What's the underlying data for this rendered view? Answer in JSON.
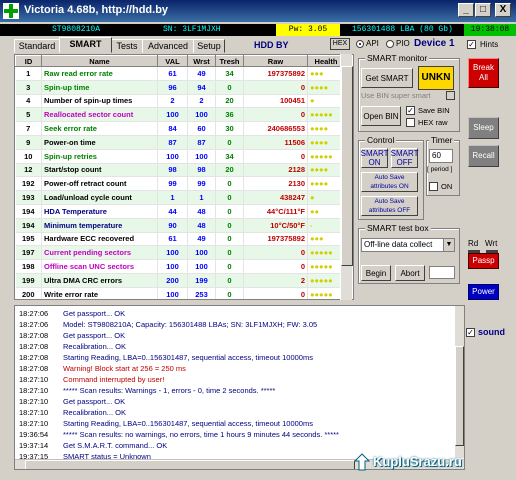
{
  "window": {
    "title": "Victoria 4.68b, http://hdd.by",
    "minimize_glyph": "_",
    "maximize_glyph": "□",
    "close_glyph": "X"
  },
  "infobar": {
    "model": "ST9808210A",
    "serial": "SN: 3LF1MJXH",
    "power": "Pw: 3.05",
    "capacity": "156301488 LBA (80 Gb)",
    "clock": "19:38:08"
  },
  "tabs": [
    "Standard",
    "SMART",
    "Tests",
    "Advanced",
    "Setup"
  ],
  "active_tab": "SMART",
  "toolbar": {
    "hdd_label": "HDD BY",
    "hex_button": "HEX",
    "api_label": "API",
    "pio_label": "PIO",
    "device_label": "Device 1",
    "hints_label": "Hints",
    "hints_checked": true
  },
  "smart_table": {
    "columns": [
      "ID",
      "Name",
      "VAL",
      "Wrst",
      "Tresh",
      "Raw",
      "Health"
    ],
    "rows": [
      {
        "id": "1",
        "name": "Raw read error rate",
        "val": "61",
        "wrst": "49",
        "tresh": "34",
        "raw": "197375892",
        "health": "●●●",
        "name_color": "#008000"
      },
      {
        "id": "3",
        "name": "Spin-up time",
        "val": "96",
        "wrst": "94",
        "tresh": "0",
        "raw": "0",
        "health": "●●●●",
        "name_color": "#008000"
      },
      {
        "id": "4",
        "name": "Number of spin-up times",
        "val": "2",
        "wrst": "2",
        "tresh": "20",
        "raw": "100451",
        "health": "●",
        "name_color": "#000000"
      },
      {
        "id": "5",
        "name": "Reallocated sector count",
        "val": "100",
        "wrst": "100",
        "tresh": "36",
        "raw": "0",
        "health": "●●●●●",
        "name_color": "#c000c0"
      },
      {
        "id": "7",
        "name": "Seek error rate",
        "val": "84",
        "wrst": "60",
        "tresh": "30",
        "raw": "240686553",
        "health": "●●●●",
        "name_color": "#008000"
      },
      {
        "id": "9",
        "name": "Power-on time",
        "val": "87",
        "wrst": "87",
        "tresh": "0",
        "raw": "11506",
        "health": "●●●●",
        "name_color": "#000000"
      },
      {
        "id": "10",
        "name": "Spin-up retries",
        "val": "100",
        "wrst": "100",
        "tresh": "34",
        "raw": "0",
        "health": "●●●●●",
        "name_color": "#008000"
      },
      {
        "id": "12",
        "name": "Start/stop count",
        "val": "98",
        "wrst": "98",
        "tresh": "20",
        "raw": "2128",
        "health": "●●●●",
        "name_color": "#000000"
      },
      {
        "id": "192",
        "name": "Power-off retract count",
        "val": "99",
        "wrst": "99",
        "tresh": "0",
        "raw": "2130",
        "health": "●●●●",
        "name_color": "#000000"
      },
      {
        "id": "193",
        "name": "Load/unload cycle count",
        "val": "1",
        "wrst": "1",
        "tresh": "0",
        "raw": "438247",
        "health": "●",
        "name_color": "#000000"
      },
      {
        "id": "194",
        "name": "HDA Temperature",
        "val": "44",
        "wrst": "48",
        "tresh": "0",
        "raw": "44°C/111°F",
        "health": "●●",
        "name_color": "#000080"
      },
      {
        "id": "194",
        "name": "Minimum temperature",
        "val": "90",
        "wrst": "48",
        "tresh": "0",
        "raw": "10°C/50°F",
        "health": "-",
        "name_color": "#000080"
      },
      {
        "id": "195",
        "name": "Hardware ECC recovered",
        "val": "61",
        "wrst": "49",
        "tresh": "0",
        "raw": "197375892",
        "health": "●●●",
        "name_color": "#000000"
      },
      {
        "id": "197",
        "name": "Current pending sectors",
        "val": "100",
        "wrst": "100",
        "tresh": "0",
        "raw": "0",
        "health": "●●●●●",
        "name_color": "#c000c0"
      },
      {
        "id": "198",
        "name": "Offline scan UNC sectors",
        "val": "100",
        "wrst": "100",
        "tresh": "0",
        "raw": "0",
        "health": "●●●●●",
        "name_color": "#c000c0"
      },
      {
        "id": "199",
        "name": "Ultra DMA CRC errors",
        "val": "200",
        "wrst": "199",
        "tresh": "0",
        "raw": "2",
        "health": "●●●●●",
        "name_color": "#000000"
      },
      {
        "id": "200",
        "name": "Write error rate",
        "val": "100",
        "wrst": "253",
        "tresh": "0",
        "raw": "0",
        "health": "●●●●●",
        "name_color": "#000000"
      }
    ]
  },
  "smart_monitor": {
    "title": "SMART monitor",
    "get_smart": "Get SMART",
    "status": "UNKN",
    "use_bin": "Use BIN super smart",
    "open_bin": "Open BIN",
    "save_bin": "Save BIN",
    "save_bin_checked": true,
    "hex_raw": "HEX raw",
    "hex_raw_checked": false
  },
  "control": {
    "title": "Control",
    "smart_on": "SMART ON",
    "smart_off": "SMART OFF",
    "autosave_on": "Auto Save attributes ON",
    "autosave_off": "Auto Save attributes OFF"
  },
  "timer": {
    "title": "Timer",
    "value": "60",
    "period": "[ period ]",
    "on_label": "ON"
  },
  "test_box": {
    "title": "SMART test box",
    "selected": "Off-line data collect",
    "begin": "Begin",
    "abort": "Abort"
  },
  "side_buttons": {
    "break_all": "Break All",
    "sleep": "Sleep",
    "recall": "Recall",
    "rd": "Rd",
    "wrt": "Wrt",
    "passp": "Passp",
    "power": "Power"
  },
  "log": [
    {
      "time": "18:27:06",
      "msg": "Get passport... OK",
      "color": "#000080"
    },
    {
      "time": "18:27:06",
      "msg": "Model: ST9808210A; Capacity: 156301488 LBAs; SN: 3LF1MJXH; FW: 3.05",
      "color": "#000080"
    },
    {
      "time": "18:27:08",
      "msg": "Get passport... OK",
      "color": "#000080"
    },
    {
      "time": "18:27:08",
      "msg": "Recalibration... OK",
      "color": "#000080"
    },
    {
      "time": "18:27:08",
      "msg": "Starting Reading, LBA=0..156301487, sequential access, timeout 10000ms",
      "color": "#000080"
    },
    {
      "time": "18:27:08",
      "msg": "Warning! Block start at 256 = 250 ms",
      "color": "#c00000"
    },
    {
      "time": "18:27:10",
      "msg": "Command interrupted by user!",
      "color": "#c00000"
    },
    {
      "time": "18:27:10",
      "msg": "***** Scan results: Warnings - 1, errors - 0, time 2 seconds. *****",
      "color": "#000080"
    },
    {
      "time": "18:27:10",
      "msg": "Get passport... OK",
      "color": "#000080"
    },
    {
      "time": "18:27:10",
      "msg": "Recalibration... OK",
      "color": "#000080"
    },
    {
      "time": "18:27:10",
      "msg": "Starting Reading, LBA=0..156301487, sequential access, timeout 10000ms",
      "color": "#000080"
    },
    {
      "time": "19:36:54",
      "msg": "***** Scan results: no warnings, no errors, time 1 hours 9 minutes 44 seconds. *****",
      "color": "#000080"
    },
    {
      "time": "19:37:14",
      "msg": "Get S.M.A.R.T. command... OK",
      "color": "#000080"
    },
    {
      "time": "19:37:15",
      "msg": "SMART status = Unknown",
      "color": "#000080"
    }
  ],
  "sound_label": "sound",
  "sound_checked": true,
  "watermark": "KupluSrazu.ru",
  "colors": {
    "title_bar": "#0a246a",
    "grid_alt_row": "#e8f8e8",
    "unkn_badge": "#ffd700",
    "break_all": "#cc0000",
    "power": "#0000c0"
  }
}
